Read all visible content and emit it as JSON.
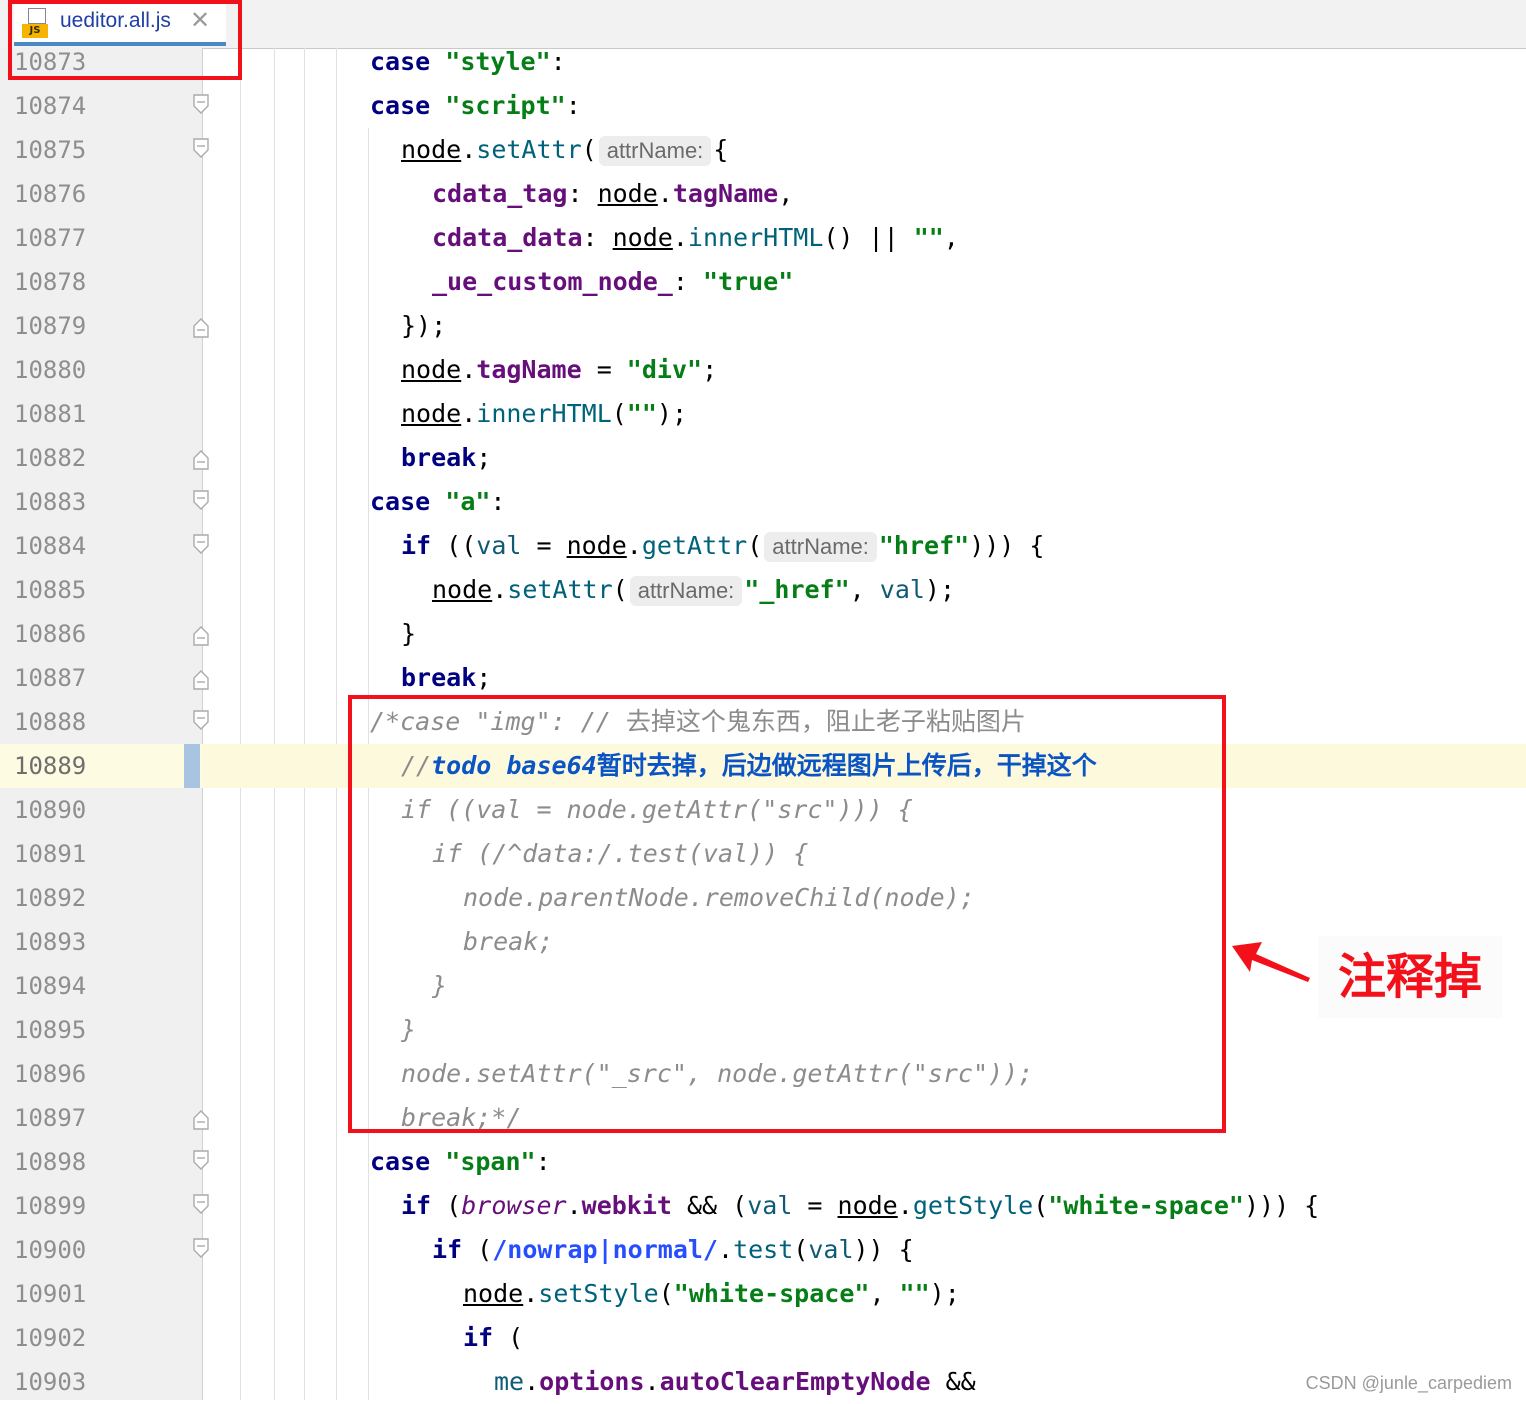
{
  "tab": {
    "filename": "ueditor.all.js",
    "file_icon": "js-file-icon",
    "file_icon_badge": "JS",
    "close_glyph": "✕"
  },
  "editor": {
    "current_line": 10889
  },
  "lines": [
    {
      "num": "10873"
    },
    {
      "num": "10874"
    },
    {
      "num": "10875"
    },
    {
      "num": "10876"
    },
    {
      "num": "10877"
    },
    {
      "num": "10878"
    },
    {
      "num": "10879"
    },
    {
      "num": "10880"
    },
    {
      "num": "10881"
    },
    {
      "num": "10882"
    },
    {
      "num": "10883"
    },
    {
      "num": "10884"
    },
    {
      "num": "10885"
    },
    {
      "num": "10886"
    },
    {
      "num": "10887"
    },
    {
      "num": "10888"
    },
    {
      "num": "10889"
    },
    {
      "num": "10890"
    },
    {
      "num": "10891"
    },
    {
      "num": "10892"
    },
    {
      "num": "10893"
    },
    {
      "num": "10894"
    },
    {
      "num": "10895"
    },
    {
      "num": "10896"
    },
    {
      "num": "10897"
    },
    {
      "num": "10898"
    },
    {
      "num": "10899"
    },
    {
      "num": "10900"
    },
    {
      "num": "10901"
    },
    {
      "num": "10902"
    },
    {
      "num": "10903"
    }
  ],
  "code": {
    "l10873": {
      "t1": "case ",
      "t2": "\"style\"",
      "t3": ":"
    },
    "l10874": {
      "t1": "case ",
      "t2": "\"script\"",
      "t3": ":"
    },
    "l10875": {
      "t1": "node",
      "t2": ".",
      "t3": "setAttr",
      "t4": "(",
      "hint": "attrName:",
      "t5": "{"
    },
    "l10876": {
      "t1": "cdata_tag",
      "t2": ": ",
      "t3": "node",
      "t4": ".",
      "t5": "tagName",
      "t6": ","
    },
    "l10877": {
      "t1": "cdata_data",
      "t2": ": ",
      "t3": "node",
      "t4": ".",
      "t5": "innerHTML",
      "t6": "() || ",
      "t7": "\"\"",
      "t8": ","
    },
    "l10878": {
      "t1": "_ue_custom_node_",
      "t2": ": ",
      "t3": "\"true\""
    },
    "l10879": {
      "t1": "});"
    },
    "l10880": {
      "t1": "node",
      "t2": ".",
      "t3": "tagName",
      "t4": " = ",
      "t5": "\"div\"",
      "t6": ";"
    },
    "l10881": {
      "t1": "node",
      "t2": ".",
      "t3": "innerHTML",
      "t4": "(",
      "t5": "\"\"",
      "t6": ");"
    },
    "l10882": {
      "t1": "break",
      ";": ";",
      "t2": ";"
    },
    "l10883": {
      "t1": "case ",
      "t2": "\"a\"",
      "t3": ":"
    },
    "l10884": {
      "t1": "if ",
      "t2": "((",
      "t3": "val",
      "t4": " = ",
      "t5": "node",
      "t6": ".",
      "t7": "getAttr",
      "t8": "(",
      "hint": "attrName:",
      "t9": "\"href\"",
      "t10": "))) {"
    },
    "l10885": {
      "t1": "node",
      "t2": ".",
      "t3": "setAttr",
      "t4": "(",
      "hint": "attrName:",
      "t5": "\"_href\"",
      "t6": ", ",
      "t7": "val",
      "t8": ");"
    },
    "l10886": {
      "t1": "}"
    },
    "l10887": {
      "t1": "break",
      "t2": ";"
    },
    "l10888": {
      "t1": "/*case \"img\": // ",
      "t2": "去掉这个鬼东西，阻止老子粘贴图片"
    },
    "l10889": {
      "t1": "//",
      "t2": "todo base64",
      "t3": "暂时去掉，后边做远程图片上传后，干掉这个"
    },
    "l10890": {
      "t1": "if ((val = node.getAttr(\"src\"))) {"
    },
    "l10891": {
      "t1": "if (/^data:/.test(val)) {"
    },
    "l10892": {
      "t1": "node.parentNode.removeChild(node);"
    },
    "l10893": {
      "t1": "break;"
    },
    "l10894": {
      "t1": "}"
    },
    "l10895": {
      "t1": "}"
    },
    "l10896": {
      "t1": "node.setAttr(\"_src\", node.getAttr(\"src\"));"
    },
    "l10897": {
      "t1": "break;*/"
    },
    "l10898": {
      "t1": "case ",
      "t2": "\"span\"",
      "t3": ":"
    },
    "l10899": {
      "t1": "if ",
      "t2": "(",
      "t3": "browser",
      "t4": ".",
      "t5": "webkit",
      "t6": " && (",
      "t7": "val",
      "t8": " = ",
      "t9": "node",
      "t10": ".",
      "t11": "getStyle",
      "t12": "(",
      "t13": "\"white-space\"",
      "t14": "))) {"
    },
    "l10900": {
      "t1": "if ",
      "t2": "(",
      "t3": "/nowrap|normal/",
      "t4": ".",
      "t5": "test",
      "t6": "(",
      "t7": "val",
      "t8": ")) {"
    },
    "l10901": {
      "t1": "node",
      "t2": ".",
      "t3": "setStyle",
      "t4": "(",
      "t5": "\"white-space\"",
      "t6": ", ",
      "t7": "\"\"",
      "t8": ");"
    },
    "l10902": {
      "t1": "if ",
      "t2": "("
    },
    "l10903": {
      "t1": "me",
      "t2": ".",
      "t3": "options",
      "t4": ".",
      "t5": "autoClearEmptyNode",
      "t6": " &&"
    }
  },
  "annotation": {
    "note": "注释掉",
    "highlight_color": "#f2101a"
  },
  "watermark": "CSDN @junle_carpediem"
}
